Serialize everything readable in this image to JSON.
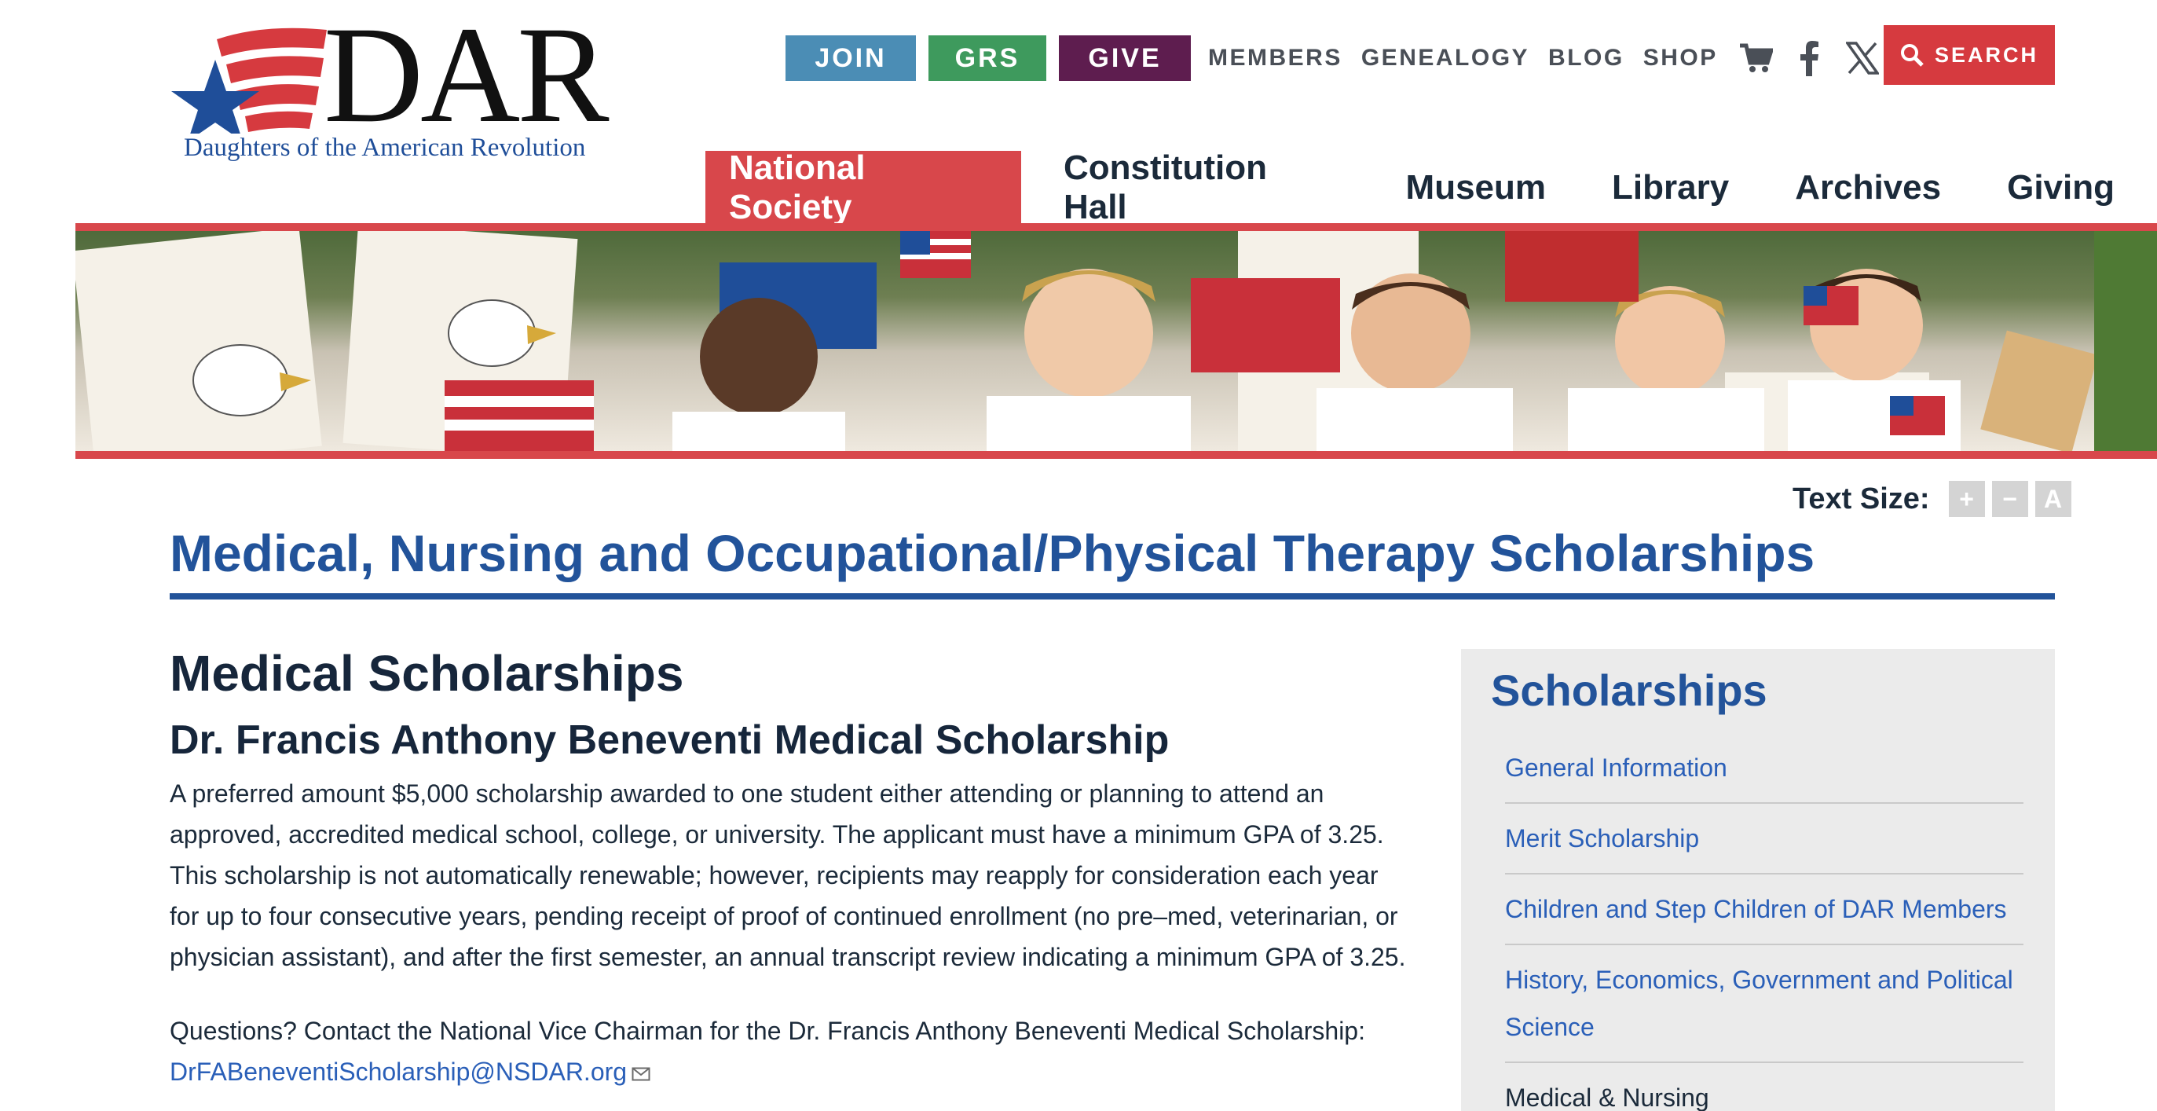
{
  "logo": {
    "text": "DAR",
    "subtitle": "Daughters of the American Revolution"
  },
  "utility": {
    "join": "JOIN",
    "grs": "GRS",
    "give": "GIVE",
    "links": [
      "MEMBERS",
      "GENEALOGY",
      "BLOG",
      "SHOP"
    ],
    "search": "SEARCH"
  },
  "nav": [
    "National Society",
    "Constitution Hall",
    "Museum",
    "Library",
    "Archives",
    "Giving"
  ],
  "text_size": {
    "label": "Text Size:",
    "increase": "+",
    "decrease": "−",
    "reset": "A"
  },
  "page_title": "Medical, Nursing and Occupational/Physical Therapy Scholarships",
  "main": {
    "section_heading": "Medical Scholarships",
    "scholarship_heading": "Dr. Francis Anthony Beneventi Medical Scholarship",
    "description": "A preferred amount $5,000 scholarship awarded to one student either attending or planning to attend an approved, accredited medical school, college, or university. The applicant must have a minimum GPA of 3.25. This scholarship is not automatically renewable; however, recipients may reapply for consideration each year for up to four consecutive years, pending receipt of proof of continued enrollment (no pre–med, veterinarian, or physician assistant), and after the first semester, an annual transcript review indicating a minimum GPA of 3.25.",
    "contact_text": "Questions? Contact the National Vice Chairman for the Dr. Francis Anthony Beneventi Medical Scholarship: ",
    "contact_email": "DrFABeneventiScholarship@NSDAR.org"
  },
  "sidebar": {
    "title": "Scholarships",
    "items": [
      "General Information",
      "Merit Scholarship",
      "Children and Step Children of DAR Members",
      "History, Economics, Government and Political Science",
      "Medical & Nursing"
    ]
  },
  "colors": {
    "accent_red": "#d8474b",
    "primary_blue": "#22539a",
    "join": "#4b8db5",
    "grs": "#3e9a5d",
    "give": "#5e1d4f"
  }
}
